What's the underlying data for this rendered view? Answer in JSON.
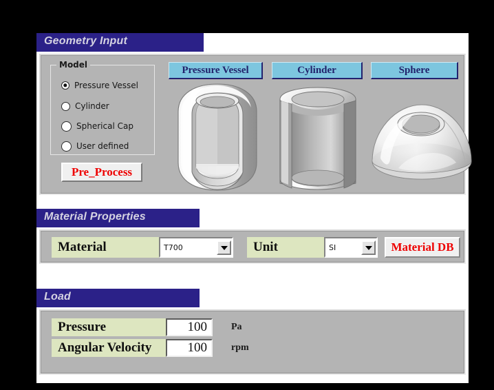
{
  "colors": {
    "header_bar": "#2B2188",
    "header_text": "#D5D3E2",
    "panel_gray": "#B4B4B4",
    "field_label_green": "#DDE6C0",
    "tab_blue": "#7DC6DF",
    "tab_text_navy": "#22226B",
    "action_red": "#EE0000",
    "page_background": "#000000",
    "window_background": "#FFFFFF"
  },
  "geometry": {
    "header_title": "Geometry Input",
    "model_group": {
      "legend": "Model",
      "selected": "Pressure Vessel",
      "options": [
        {
          "label": "Pressure Vessel",
          "checked": true
        },
        {
          "label": "Cylinder",
          "checked": false
        },
        {
          "label": "Spherical Cap",
          "checked": false
        },
        {
          "label": "User defined",
          "checked": false
        }
      ]
    },
    "pre_process_button": "Pre_Process",
    "preview_tabs": [
      {
        "label": "Pressure Vessel",
        "figure": "cutaway-pressure-vessel"
      },
      {
        "label": "Cylinder",
        "figure": "cutaway-hollow-cylinder"
      },
      {
        "label": "Sphere",
        "figure": "spherical-cap-dome"
      }
    ]
  },
  "material": {
    "header_title": "Material Properties",
    "material_label": "Material",
    "material_value": "T700",
    "unit_label": "Unit",
    "unit_value": "SI",
    "material_db_button": "Material DB"
  },
  "load": {
    "header_title": "Load",
    "rows": [
      {
        "label": "Pressure",
        "value": "100",
        "unit": "Pa"
      },
      {
        "label": "Angular Velocity",
        "value": "100",
        "unit": "rpm"
      }
    ]
  }
}
